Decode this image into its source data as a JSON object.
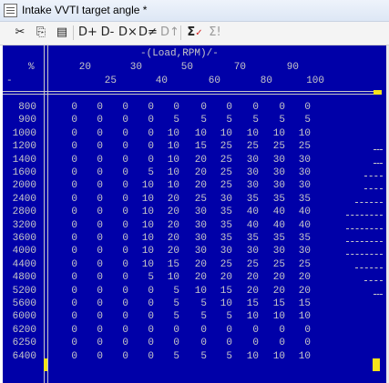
{
  "window": {
    "title": "Intake VVTI target angle *"
  },
  "toolbar": [
    {
      "name": "cut-icon",
      "glyph": "✂"
    },
    {
      "name": "copy-icon",
      "glyph": "⎘"
    },
    {
      "name": "paste-icon",
      "glyph": "▤"
    },
    {
      "name": "insert-row-icon",
      "glyph": "D+"
    },
    {
      "name": "delete-row-icon",
      "glyph": "D-"
    },
    {
      "name": "insert-col-icon",
      "glyph": "D×"
    },
    {
      "name": "delete-col-icon",
      "glyph": "D≠"
    },
    {
      "name": "fill-icon",
      "glyph": "D↑"
    },
    {
      "name": "sigma-check-icon",
      "glyph": "Σ"
    },
    {
      "name": "sigma-icon",
      "glyph": "Σ!"
    }
  ],
  "table": {
    "header_title": "-(Load,RPM)/-",
    "corner_unit": "%",
    "corner_minus": "-",
    "columns": [
      20,
      25,
      30,
      40,
      50,
      60,
      70,
      80,
      90,
      100
    ],
    "rows": [
      {
        "rpm": "800",
        "v": [
          0,
          0,
          0,
          0,
          0,
          0,
          0,
          0,
          0,
          0
        ]
      },
      {
        "rpm": "900",
        "v": [
          0,
          0,
          0,
          0,
          5,
          5,
          5,
          5,
          5,
          5
        ]
      },
      {
        "rpm": "1000",
        "v": [
          0,
          0,
          0,
          0,
          10,
          10,
          10,
          10,
          10,
          10
        ]
      },
      {
        "rpm": "1200",
        "v": [
          0,
          0,
          0,
          0,
          10,
          15,
          25,
          25,
          25,
          25
        ]
      },
      {
        "rpm": "1400",
        "v": [
          0,
          0,
          0,
          0,
          10,
          20,
          25,
          30,
          30,
          30
        ]
      },
      {
        "rpm": "1600",
        "v": [
          0,
          0,
          0,
          5,
          10,
          20,
          25,
          30,
          30,
          30
        ]
      },
      {
        "rpm": "2000",
        "v": [
          0,
          0,
          0,
          10,
          10,
          20,
          25,
          30,
          30,
          30
        ]
      },
      {
        "rpm": "2400",
        "v": [
          0,
          0,
          0,
          10,
          20,
          25,
          30,
          35,
          35,
          35
        ]
      },
      {
        "rpm": "2800",
        "v": [
          0,
          0,
          0,
          10,
          20,
          30,
          35,
          40,
          40,
          40
        ]
      },
      {
        "rpm": "3200",
        "v": [
          0,
          0,
          0,
          10,
          20,
          30,
          35,
          40,
          40,
          40
        ]
      },
      {
        "rpm": "3600",
        "v": [
          0,
          0,
          0,
          10,
          20,
          30,
          35,
          35,
          35,
          35
        ]
      },
      {
        "rpm": "4000",
        "v": [
          0,
          0,
          0,
          10,
          20,
          30,
          30,
          30,
          30,
          30
        ]
      },
      {
        "rpm": "4400",
        "v": [
          0,
          0,
          0,
          10,
          15,
          20,
          25,
          25,
          25,
          25
        ]
      },
      {
        "rpm": "4800",
        "v": [
          0,
          0,
          0,
          5,
          10,
          20,
          20,
          20,
          20,
          20
        ]
      },
      {
        "rpm": "5200",
        "v": [
          0,
          0,
          0,
          0,
          5,
          10,
          15,
          20,
          20,
          20
        ]
      },
      {
        "rpm": "5600",
        "v": [
          0,
          0,
          0,
          0,
          5,
          5,
          10,
          15,
          15,
          15
        ]
      },
      {
        "rpm": "6000",
        "v": [
          0,
          0,
          0,
          0,
          5,
          5,
          5,
          10,
          10,
          10
        ]
      },
      {
        "rpm": "6200",
        "v": [
          0,
          0,
          0,
          0,
          0,
          0,
          0,
          0,
          0,
          0
        ]
      },
      {
        "rpm": "6250",
        "v": [
          0,
          0,
          0,
          0,
          0,
          0,
          0,
          0,
          0,
          0
        ]
      },
      {
        "rpm": "6400",
        "v": [
          0,
          0,
          0,
          0,
          5,
          5,
          5,
          10,
          10,
          10
        ]
      }
    ]
  },
  "colors": {
    "background": "#0000a8",
    "text": "#c8c8c8",
    "cursor": "#f4e21a"
  }
}
